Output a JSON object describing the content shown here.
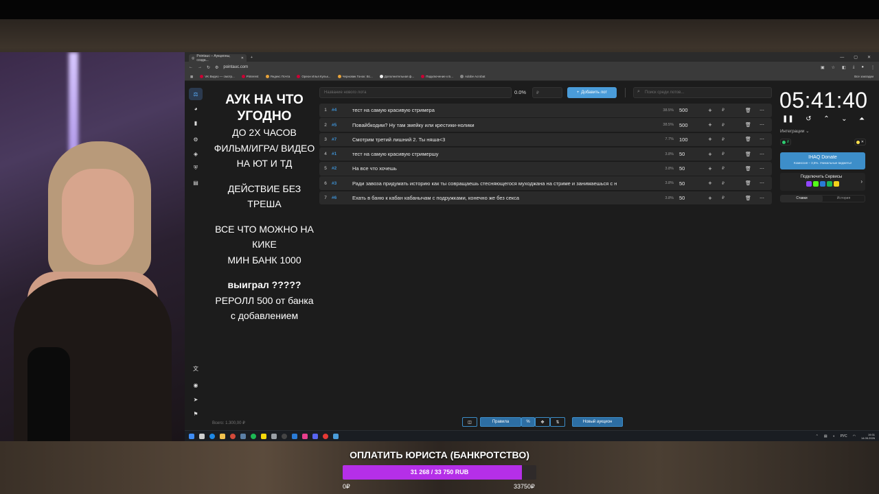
{
  "browser": {
    "tab_title": "Pointauc – Аукционы, созда...",
    "url": "pointauc.com",
    "bookmarks": [
      "VK Видео — смотр...",
      "Pinterest",
      "Яндекс Почта",
      "Ореон Илья Кульк...",
      "Черновик Гонок: Вс...",
      "Дополнительная ф...",
      "Подключение к Б...",
      "Adobe Acrobat"
    ],
    "all_bookmarks": "Все закладки"
  },
  "rules": {
    "title": "АУК НА ЧТО УГОДНО",
    "lines": [
      "ДО 2Х ЧАСОВ",
      "ФИЛЬМ/ИГРА/ ВИДЕО НА ЮТ И ТД",
      "ДЕЙСТВИЕ БЕЗ ТРЕША",
      "ВСЕ ЧТО МОЖНО НА КИКЕ",
      "МИН БАНК 1000",
      "выиграл ?????",
      "РЕРОЛЛ 500 от банка с добавлением"
    ]
  },
  "toolbar": {
    "lot_placeholder": "Название нового лота",
    "percent": "0.0%",
    "amount_placeholder": "₽",
    "add_label": "Добавить лот",
    "search_placeholder": "Поиск среди лотов..."
  },
  "lots": [
    {
      "n": "1",
      "id": "#4",
      "name": "тест на самую красивую стримера",
      "pct": "38.5%",
      "amount": "500"
    },
    {
      "n": "2",
      "id": "#5",
      "name": "Повайбкодим? Ну там змейку или крестики-нолики",
      "pct": "38.5%",
      "amount": "500"
    },
    {
      "n": "3",
      "id": "#7",
      "name": "Смотрим третий лишний 2. Ты няша<3",
      "pct": "7.7%",
      "amount": "100"
    },
    {
      "n": "4",
      "id": "#1",
      "name": "тест на самую красивую стримершу",
      "pct": "3.8%",
      "amount": "50"
    },
    {
      "n": "5",
      "id": "#2",
      "name": "На все что хочешь",
      "pct": "3.8%",
      "amount": "50"
    },
    {
      "n": "6",
      "id": "#3",
      "name": "Ради завоза придумать историю как ты совращаешь стесняющегося муходжана на стриме и занимаешься с н",
      "pct": "3.8%",
      "amount": "50"
    },
    {
      "n": "7",
      "id": "#6",
      "name": "Ехать в баню к кабан кабанычам с подружками, конечно же без секса",
      "pct": "3.8%",
      "amount": "50"
    }
  ],
  "timer": {
    "value": "05:41:40"
  },
  "panel": {
    "integrations": "Интеграции",
    "donate_title": "IHAQ Donate",
    "donate_sub": "Комиссия – 3,5%. Уникальные виджеты!",
    "connect": "Подключить Сервисы",
    "tab_bets": "Ставки",
    "tab_history": "История"
  },
  "footer": {
    "total": "Всего: 1.300,00 ₽",
    "rules": "Правила",
    "percent_symbol": "%",
    "new_auction": "Новый аукцион"
  },
  "taskbar": {
    "lang": "РУС",
    "time": "19:31",
    "date": "14.05.2026"
  },
  "goal": {
    "title": "ОПЛАТИТЬ ЮРИСТА (БАНКРОТСТВО)",
    "progress_text": "31 268 / 33 750 RUB",
    "current": 31268,
    "target": 33750,
    "min_label": "0₽",
    "max_label": "33750₽",
    "fill_color": "#b52fe8"
  }
}
